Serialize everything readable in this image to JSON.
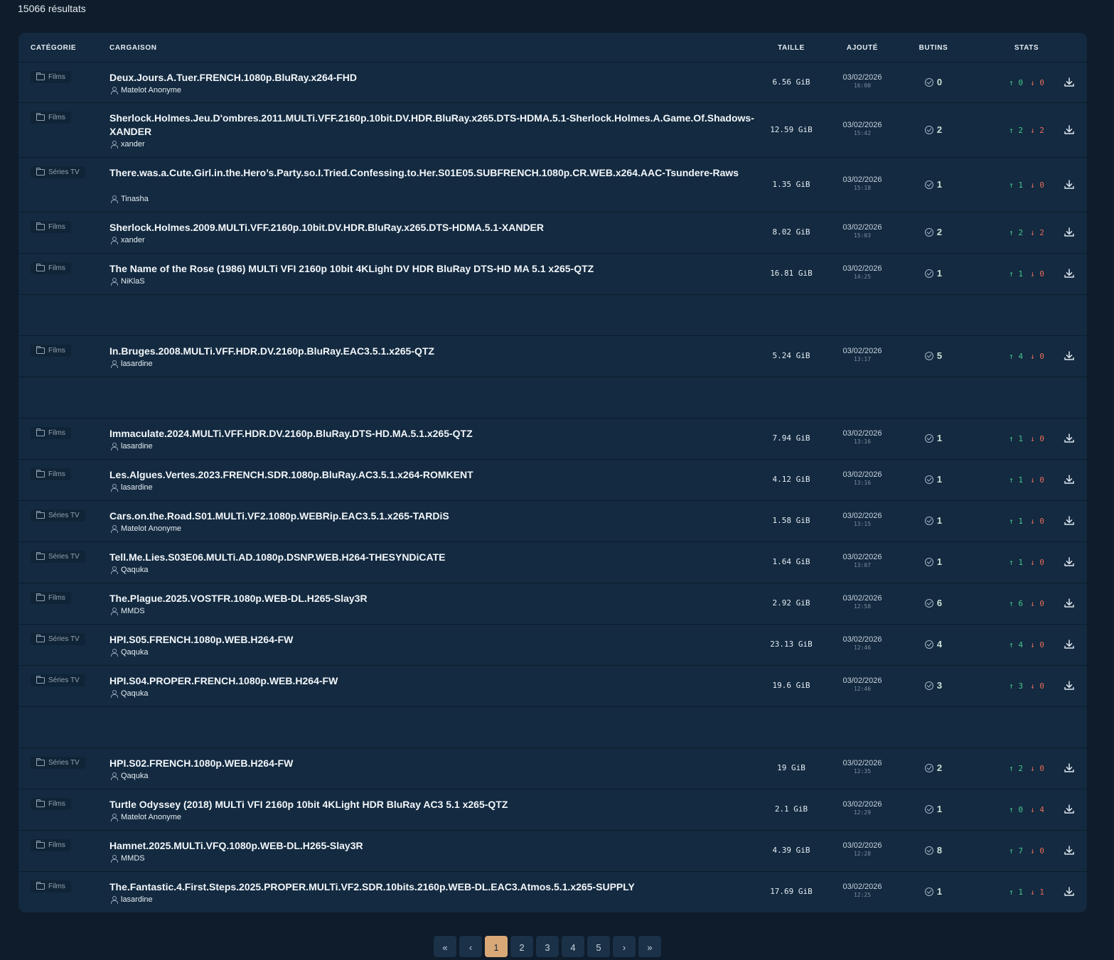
{
  "results_count": "15066 résultats",
  "headers": {
    "category": "CATÉGORIE",
    "cargo": "CARGAISON",
    "size": "TAILLE",
    "added": "AJOUTÉ",
    "loot": "BUTINS",
    "stats": "STATS"
  },
  "rows": [
    {
      "category": "Films",
      "title": "Deux.Jours.A.Tuer.FRENCH.1080p.BluRay.x264-FHD",
      "uploader": "Matelot Anonyme",
      "size": "6.56 GiB",
      "date": "03/02/2026",
      "time": "16:00",
      "loot": "0",
      "seeders": "0",
      "leechers": "0"
    },
    {
      "category": "Films",
      "title": "Sherlock.Holmes.Jeu.D'ombres.2011.MULTi.VFF.2160p.10bit.DV.HDR.BluRay.x265.DTS-HDMA.5.1-Sherlock.Holmes.A.Game.Of.Shadows-XANDER",
      "uploader": "xander",
      "size": "12.59 GiB",
      "date": "03/02/2026",
      "time": "15:42",
      "loot": "2",
      "seeders": "2",
      "leechers": "2"
    },
    {
      "category": "Séries TV",
      "title": "There.was.a.Cute.Girl.in.the.Hero’s.Party.so.I.Tried.Confessing.to.Her.S01E05.SUBFRENCH.1080p.CR.WEB.x264.AAC-Tsundere-Raws",
      "uploader": "Tinasha",
      "size": "1.35 GiB",
      "date": "03/02/2026",
      "time": "15:18",
      "loot": "1",
      "seeders": "1",
      "leechers": "0"
    },
    {
      "category": "Films",
      "title": "Sherlock.Holmes.2009.MULTi.VFF.2160p.10bit.DV.HDR.BluRay.x265.DTS-HDMA.5.1-XANDER",
      "uploader": "xander",
      "size": "8.02 GiB",
      "date": "03/02/2026",
      "time": "15:03",
      "loot": "2",
      "seeders": "2",
      "leechers": "2"
    },
    {
      "category": "Films",
      "title": "The Name of the Rose (1986) MULTi VFI 2160p 10bit 4KLight DV HDR BluRay DTS-HD MA 5.1 x265-QTZ",
      "uploader": "NiKlaS",
      "size": "16.81 GiB",
      "date": "03/02/2026",
      "time": "14:25",
      "loot": "1",
      "seeders": "1",
      "leechers": "0"
    },
    {
      "category": "Films",
      "title": "In.Bruges.2008.MULTi.VFF.HDR.DV.2160p.BluRay.EAC3.5.1.x265-QTZ",
      "uploader": "lasardine",
      "size": "5.24 GiB",
      "date": "03/02/2026",
      "time": "13:17",
      "loot": "5",
      "seeders": "4",
      "leechers": "0"
    },
    {
      "category": "Films",
      "title": "Immaculate.2024.MULTi.VFF.HDR.DV.2160p.BluRay.DTS-HD.MA.5.1.x265-QTZ",
      "uploader": "lasardine",
      "size": "7.94 GiB",
      "date": "03/02/2026",
      "time": "13:16",
      "loot": "1",
      "seeders": "1",
      "leechers": "0"
    },
    {
      "category": "Films",
      "title": "Les.Algues.Vertes.2023.FRENCH.SDR.1080p.BluRay.AC3.5.1.x264-ROMKENT",
      "uploader": "lasardine",
      "size": "4.12 GiB",
      "date": "03/02/2026",
      "time": "13:16",
      "loot": "1",
      "seeders": "1",
      "leechers": "0"
    },
    {
      "category": "Séries TV",
      "title": "Cars.on.the.Road.S01.MULTi.VF2.1080p.WEBRip.EAC3.5.1.x265-TARDiS",
      "uploader": "Matelot Anonyme",
      "size": "1.58 GiB",
      "date": "03/02/2026",
      "time": "13:15",
      "loot": "1",
      "seeders": "1",
      "leechers": "0"
    },
    {
      "category": "Séries TV",
      "title": "Tell.Me.Lies.S03E06.MULTi.AD.1080p.DSNP.WEB.H264-THESYNDiCATE",
      "uploader": "Qaquka",
      "size": "1.64 GiB",
      "date": "03/02/2026",
      "time": "13:07",
      "loot": "1",
      "seeders": "1",
      "leechers": "0"
    },
    {
      "category": "Films",
      "title": "The.Plague.2025.VOSTFR.1080p.WEB-DL.H265-Slay3R",
      "uploader": "MMDS",
      "size": "2.92 GiB",
      "date": "03/02/2026",
      "time": "12:58",
      "loot": "6",
      "seeders": "6",
      "leechers": "0"
    },
    {
      "category": "Séries TV",
      "title": "HPI.S05.FRENCH.1080p.WEB.H264-FW",
      "uploader": "Qaquka",
      "size": "23.13 GiB",
      "date": "03/02/2026",
      "time": "12:46",
      "loot": "4",
      "seeders": "4",
      "leechers": "0"
    },
    {
      "category": "Séries TV",
      "title": "HPI.S04.PROPER.FRENCH.1080p.WEB.H264-FW",
      "uploader": "Qaquka",
      "size": "19.6 GiB",
      "date": "03/02/2026",
      "time": "12:46",
      "loot": "3",
      "seeders": "3",
      "leechers": "0"
    },
    {
      "category": "Séries TV",
      "title": "HPI.S02.FRENCH.1080p.WEB.H264-FW",
      "uploader": "Qaquka",
      "size": "19 GiB",
      "date": "03/02/2026",
      "time": "12:35",
      "loot": "2",
      "seeders": "2",
      "leechers": "0"
    },
    {
      "category": "Films",
      "title": "Turtle Odyssey (2018) MULTi VFI 2160p 10bit 4KLight HDR BluRay AC3 5.1 x265-QTZ",
      "uploader": "Matelot Anonyme",
      "size": "2.1 GiB",
      "date": "03/02/2026",
      "time": "12:29",
      "loot": "1",
      "seeders": "0",
      "leechers": "4"
    },
    {
      "category": "Films",
      "title": "Hamnet.2025.MULTi.VFQ.1080p.WEB-DL.H265-Slay3R",
      "uploader": "MMDS",
      "size": "4.39 GiB",
      "date": "03/02/2026",
      "time": "12:28",
      "loot": "8",
      "seeders": "7",
      "leechers": "0"
    },
    {
      "category": "Films",
      "title": "The.Fantastic.4.First.Steps.2025.PROPER.MULTi.VF2.SDR.10bits.2160p.WEB-DL.EAC3.Atmos.5.1.x265-SUPPLY",
      "uploader": "lasardine",
      "size": "17.69 GiB",
      "date": "03/02/2026",
      "time": "12:25",
      "loot": "1",
      "seeders": "1",
      "leechers": "1"
    }
  ],
  "pagination": {
    "first": "«",
    "prev": "‹",
    "pages": [
      "1",
      "2",
      "3",
      "4",
      "5"
    ],
    "active": "1",
    "next": "›",
    "last": "»"
  },
  "colors": {
    "background": "#0e1c2b",
    "card": "#132a40",
    "seed": "#48c78e",
    "leech": "#e86a5a",
    "active_page": "#d9a877"
  }
}
